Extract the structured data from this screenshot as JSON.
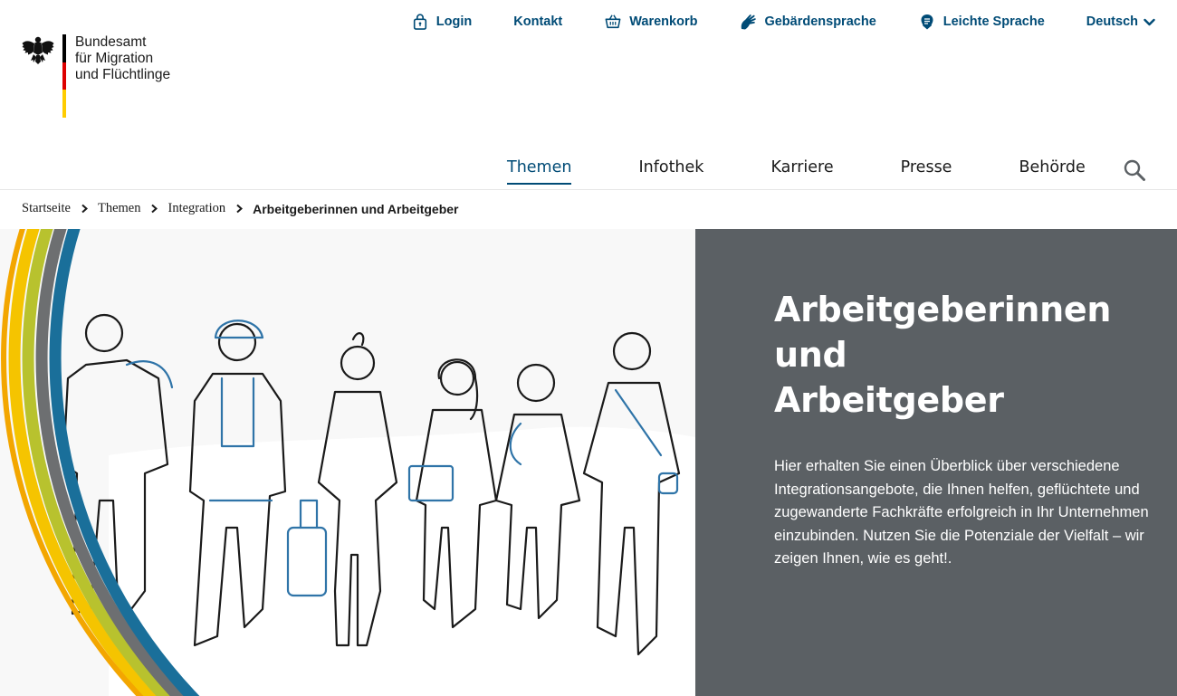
{
  "logo": {
    "line1": "Bundesamt",
    "line2": "für Migration",
    "line3": "und Flüchtlinge",
    "flag_colors": [
      "#000000",
      "#dd0000",
      "#ffcc00"
    ]
  },
  "service_nav": [
    {
      "label": "Login",
      "icon": "lock-icon"
    },
    {
      "label": "Kontakt"
    },
    {
      "label": "Warenkorb",
      "icon": "basket-icon"
    },
    {
      "label": "Gebärdensprache",
      "icon": "sign-language-icon"
    },
    {
      "label": "Leichte Sprache",
      "icon": "easy-language-icon"
    },
    {
      "label": "Deutsch",
      "icon": "chevron-down-icon"
    }
  ],
  "main_nav": [
    {
      "label": "Themen",
      "active": true
    },
    {
      "label": "Infothek"
    },
    {
      "label": "Karriere"
    },
    {
      "label": "Presse"
    },
    {
      "label": "Behörde"
    }
  ],
  "search": {
    "icon": "search-icon"
  },
  "breadcrumb": [
    "Startseite",
    "Themen",
    "Integration",
    "Arbeitgeberinnen und Arbeitgeber"
  ],
  "hero": {
    "title_line1": "Arbeitgeberinnen und",
    "title_line2": "Arbeitgeber",
    "text": "Hier erhalten Sie einen Überblick über verschiedene Integrationsangebote, die Ihnen helfen, geflüchtete und zugewanderte Fachkräfte erfolgreich in Ihr Unternehmen einzubinden. Nutzen Sie die Potenziale der Vielfalt – wir zeigen Ihnen, wie es geht!.",
    "panel_color": "#5b6064"
  },
  "colors": {
    "link_blue": "#004b76",
    "stripe_yellow": "#f5c400",
    "stripe_green": "#b8c22e",
    "stripe_blue": "#1a6f9a",
    "stripe_gray": "#6d6f71",
    "illustration_blue": "#2f74a8"
  }
}
